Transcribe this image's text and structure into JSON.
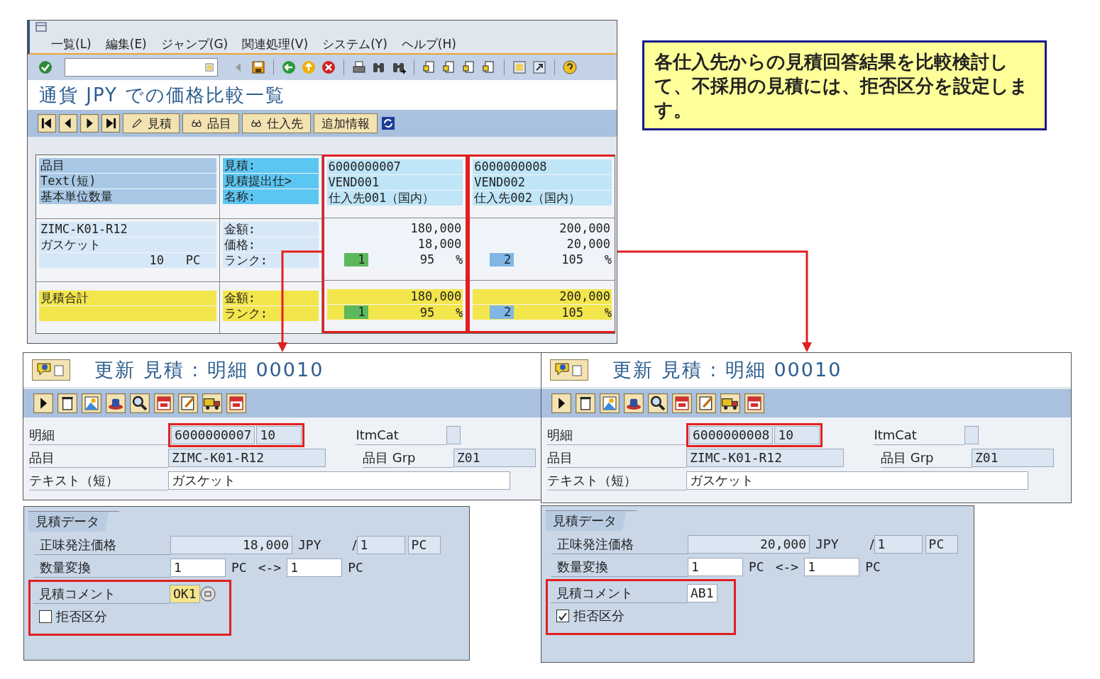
{
  "callout": {
    "text": "各仕入先からの見積回答結果を比較検討して、不採用の見積には、拒否区分を設定します。"
  },
  "comparison_window": {
    "menu": [
      "一覧(L)",
      "編集(E)",
      "ジャンプ(G)",
      "関連処理(V)",
      "システム(Y)",
      "ヘルプ(H)"
    ],
    "title": "通貨 JPY での価格比較一覧",
    "app_buttons": [
      {
        "label": "見積",
        "kind": "edit"
      },
      {
        "label": "品目",
        "kind": "view"
      },
      {
        "label": "仕入先",
        "kind": "view"
      },
      {
        "label": "追加情報",
        "kind": "plain"
      }
    ],
    "header_labels": [
      "品目",
      "Text(短)",
      "基本単位数量"
    ],
    "quote_labels": [
      "見積:",
      "見積提出仕>",
      "名称:"
    ],
    "item": {
      "material": "ZIMC-K01-R12",
      "text": "ガスケット",
      "quantity": "10",
      "unit": "PC"
    },
    "value_labels": [
      "金額:",
      "価格:",
      "ランク:"
    ],
    "total_label": "見積合計",
    "total_labels": [
      "金額:",
      "ランク:"
    ],
    "quotes": [
      {
        "number": "6000000007",
        "vendor": "VEND001",
        "name": "仕入先001（国内）",
        "amount": "180,000",
        "price": "18,000",
        "rank": "1",
        "color": "#5cb85c",
        "percent": "95",
        "percent_sign": "%",
        "total_amount": "180,000",
        "total_rank": "1",
        "total_percent": "95",
        "total_percent_sign": "%"
      },
      {
        "number": "6000000008",
        "vendor": "VEND002",
        "name": "仕入先002（国内）",
        "amount": "200,000",
        "price": "20,000",
        "rank": "2",
        "color": "#7fb6e6",
        "percent": "105",
        "percent_sign": "%",
        "total_amount": "200,000",
        "total_rank": "2",
        "total_percent": "105",
        "total_percent_sign": "%"
      }
    ]
  },
  "details": [
    {
      "title": "更新 見積 : 明細 00010",
      "item_label": "明細",
      "document": "6000000007",
      "item": "10",
      "itmcat_label": "ItmCat",
      "material_label": "品目",
      "material": "ZIMC-K01-R12",
      "matgrp_label": "品目 Grp",
      "matgrp": "Z01",
      "text_label": "テキスト（短）",
      "text": "ガスケット",
      "tab": "見積データ",
      "net_price_label": "正味発注価格",
      "net_price": "18,000",
      "currency": "JPY",
      "per_sep": "/",
      "per": "1",
      "per_unit": "PC",
      "conv_label": "数量変換",
      "conv_from": "1",
      "conv_from_unit": "PC",
      "conv_sep": "<->",
      "conv_to": "1",
      "conv_to_unit": "PC",
      "comment_label": "見積コメント",
      "comment": "OK1",
      "comment_focused": true,
      "reject_label": "拒否区分",
      "rejected": false
    },
    {
      "title": "更新 見積 : 明細 00010",
      "item_label": "明細",
      "document": "6000000008",
      "item": "10",
      "itmcat_label": "ItmCat",
      "material_label": "品目",
      "material": "ZIMC-K01-R12",
      "matgrp_label": "品目 Grp",
      "matgrp": "Z01",
      "text_label": "テキスト（短）",
      "text": "ガスケット",
      "tab": "見積データ",
      "net_price_label": "正味発注価格",
      "net_price": "20,000",
      "currency": "JPY",
      "per_sep": "/",
      "per": "1",
      "per_unit": "PC",
      "conv_label": "数量変換",
      "conv_from": "1",
      "conv_from_unit": "PC",
      "conv_sep": "<->",
      "conv_to": "1",
      "conv_to_unit": "PC",
      "comment_label": "見積コメント",
      "comment": "AB1",
      "comment_focused": false,
      "reject_label": "拒否区分",
      "rejected": true
    }
  ]
}
